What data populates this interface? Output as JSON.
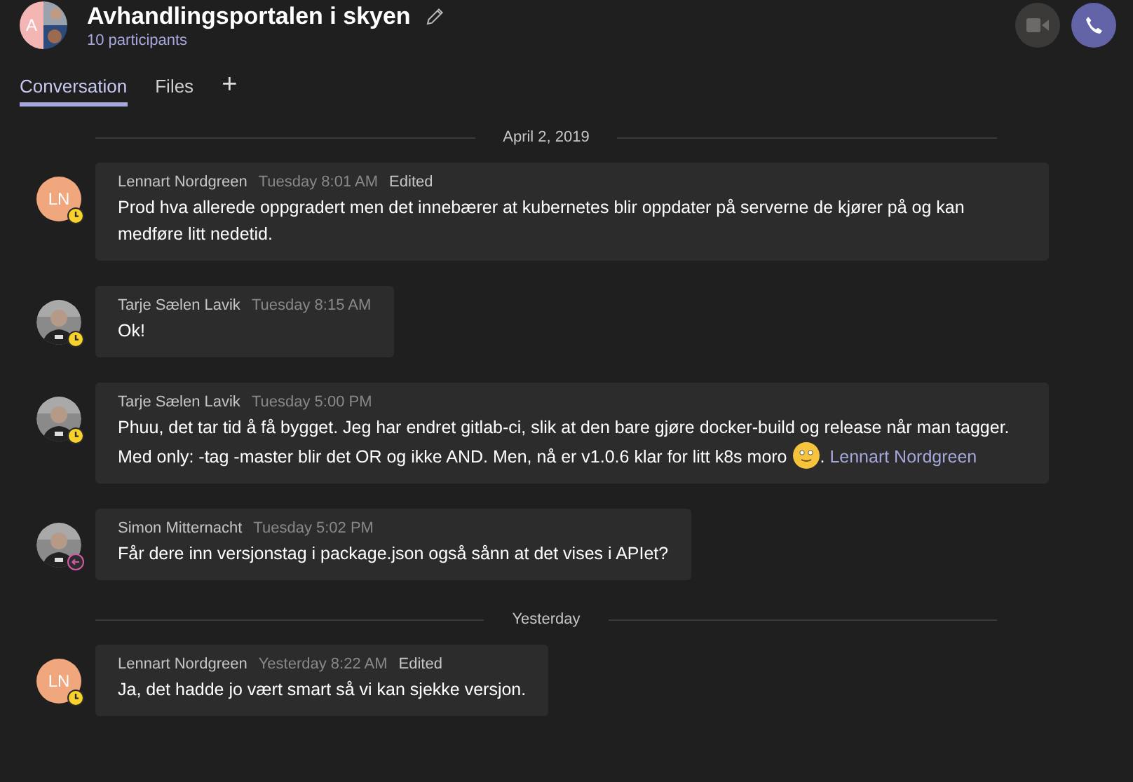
{
  "header": {
    "title": "Avhandlingsportalen i skyen",
    "subtitle": "10 participants",
    "avatar_initial": "A"
  },
  "tabs": [
    {
      "label": "Conversation",
      "selected": true
    },
    {
      "label": "Files",
      "selected": false
    },
    {
      "label": "+",
      "selected": false
    }
  ],
  "feed": [
    {
      "kind": "divider",
      "label": "April 2, 2019"
    },
    {
      "kind": "message",
      "avatar": {
        "kind": "initials",
        "initials": "LN"
      },
      "away": true,
      "out_of_office": false,
      "author": "Lennart Nordgreen",
      "time": "Tuesday 8:01 AM",
      "edited": "Edited",
      "body": [
        {
          "kind": "text",
          "text": "Prod hva allerede oppgradert men det innebærer at kubernetes blir oppdater på serverne de kjører på og kan medføre litt nedetid."
        }
      ]
    },
    {
      "kind": "message",
      "away": true,
      "out_of_office": false,
      "author": "Tarje Sælen Lavik",
      "time": "Tuesday 8:15 AM",
      "body": [
        {
          "kind": "text",
          "text": "Ok!"
        }
      ]
    },
    {
      "kind": "message",
      "away": true,
      "out_of_office": false,
      "author": "Tarje Sælen Lavik",
      "time": "Tuesday 5:00 PM",
      "body": [
        {
          "kind": "text",
          "text": "Phuu, det tar tid å få bygget. Jeg har endret gitlab-ci, slik at den bare gjøre docker-build og release når man tagger. Med only: -tag -master blir det OR og ikke AND. Men, nå er v1.0.6 klar for litt k8s moro "
        },
        {
          "kind": "emoji"
        },
        {
          "kind": "text",
          "text": ". "
        },
        {
          "kind": "mention",
          "text": "Lennart Nordgreen"
        }
      ]
    },
    {
      "kind": "message",
      "away": false,
      "out_of_office": true,
      "author": "Simon Mitternacht",
      "time": "Tuesday 5:02 PM",
      "body": [
        {
          "kind": "text",
          "text": "Får dere inn versjonstag i package.json også sånn at det vises i APIet?"
        }
      ]
    },
    {
      "kind": "divider",
      "label": "Yesterday"
    },
    {
      "kind": "message",
      "avatar": {
        "kind": "initials",
        "initials": "LN"
      },
      "away": true,
      "out_of_office": false,
      "author": "Lennart Nordgreen",
      "time": "Yesterday 8:22 AM",
      "edited": "Edited",
      "body": [
        {
          "kind": "text",
          "text": "Ja, det hadde jo vært smart så vi kan sjekke versjon."
        }
      ]
    }
  ]
}
